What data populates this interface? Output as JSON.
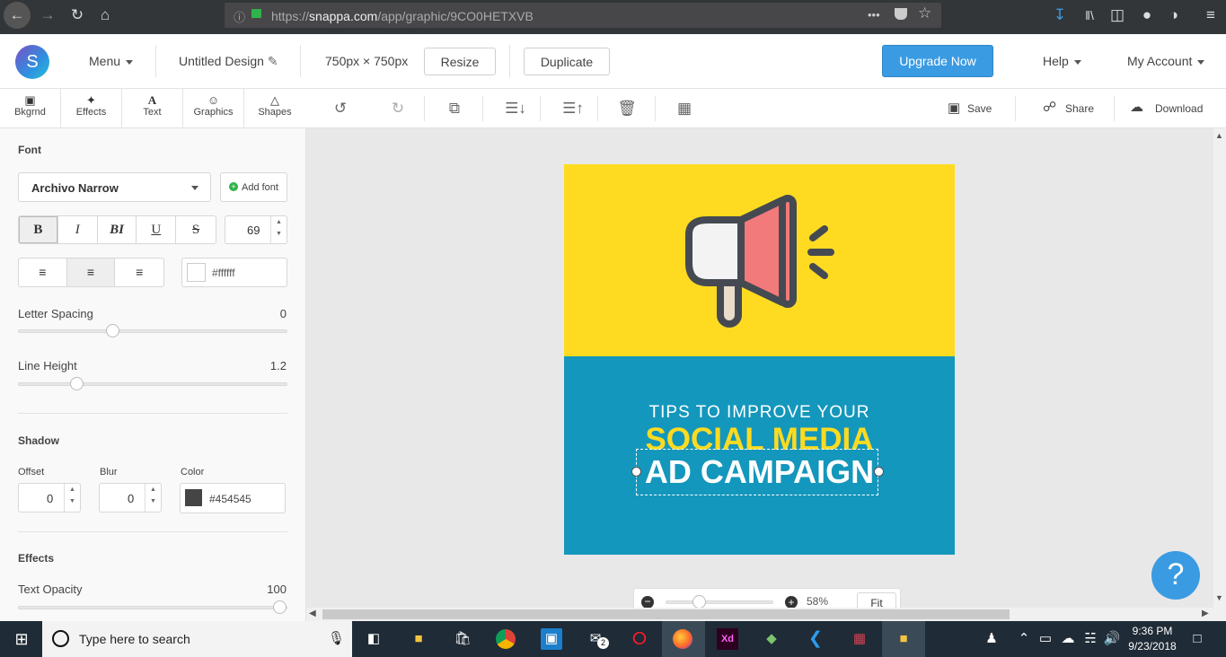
{
  "browser": {
    "url_prefix": "https://",
    "url_host": "snappa.com",
    "url_path": "/app/graphic/9CO0HETXVB",
    "url_menu": "•••"
  },
  "header": {
    "logo_letter": "S",
    "menu_label": "Menu",
    "design_name": "Untitled Design",
    "dimensions": "750px × 750px",
    "resize_label": "Resize",
    "duplicate_label": "Duplicate",
    "upgrade_label": "Upgrade Now",
    "help_label": "Help",
    "account_label": "My Account",
    "accent_color": "#3a9be2"
  },
  "tool_tabs": [
    {
      "label": "Bkgrnd",
      "icon": "image-icon"
    },
    {
      "label": "Effects",
      "icon": "wand-icon"
    },
    {
      "label": "Text",
      "icon": "text-icon"
    },
    {
      "label": "Graphics",
      "icon": "smiley-icon"
    },
    {
      "label": "Shapes",
      "icon": "triangle-icon"
    }
  ],
  "toolbar": {
    "save_label": "Save",
    "share_label": "Share",
    "download_label": "Download"
  },
  "panel": {
    "font_heading": "Font",
    "font_name": "Archivo Narrow",
    "add_font_label": "Add font",
    "style_buttons": [
      "B",
      "I",
      "BI",
      "U",
      "S"
    ],
    "font_size": "69",
    "color_value": "#ffffff",
    "letter_spacing_label": "Letter Spacing",
    "letter_spacing_value": "0",
    "letter_spacing_level": 0.34,
    "line_height_label": "Line Height",
    "line_height_value": "1.2",
    "line_height_level": 0.2,
    "shadow_heading": "Shadow",
    "offset_label": "Offset",
    "offset_value": "0",
    "blur_label": "Blur",
    "blur_value": "0",
    "shadow_color_label": "Color",
    "shadow_color_value": "#454545",
    "effects_heading": "Effects",
    "opacity_label": "Text Opacity",
    "opacity_value": "100"
  },
  "design": {
    "top_color": "#fedb21",
    "bottom_color": "#1497bc",
    "line1": "TIPS TO IMPROVE YOUR",
    "line2": "SOCIAL MEDIA",
    "line3": "AD CAMPAIGN"
  },
  "zoom": {
    "value": "58%",
    "fit_label": "Fit",
    "level": 0.28
  },
  "help_button": "?",
  "taskbar": {
    "search_placeholder": "Type here to search",
    "time": "9:36 PM",
    "date": "9/23/2018",
    "mail_badge": "2",
    "xd_label": "Xd"
  }
}
